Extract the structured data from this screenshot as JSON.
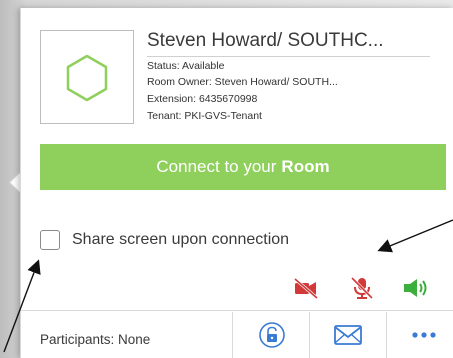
{
  "contact": {
    "name": "Steven Howard/ SOUTHC...",
    "status": "Status: Available",
    "room_owner": "Room Owner: Steven Howard/ SOUTH...",
    "extension": "Extension: 6435670998",
    "tenant": "Tenant: PKI-GVS-Tenant"
  },
  "connect": {
    "prefix": "Connect to your",
    "emphasis": "Room"
  },
  "share": {
    "label": "Share screen upon connection",
    "checked": false
  },
  "media": {
    "camera": "camera-off-icon",
    "microphone": "microphone-off-icon",
    "speaker": "speaker-on-icon"
  },
  "footer": {
    "participants": "Participants: None"
  },
  "colors": {
    "accent_green": "#8fcf5c",
    "muted_red": "#d23a3a",
    "speaker_green": "#3cae3c",
    "icon_blue": "#3a7bd5"
  }
}
